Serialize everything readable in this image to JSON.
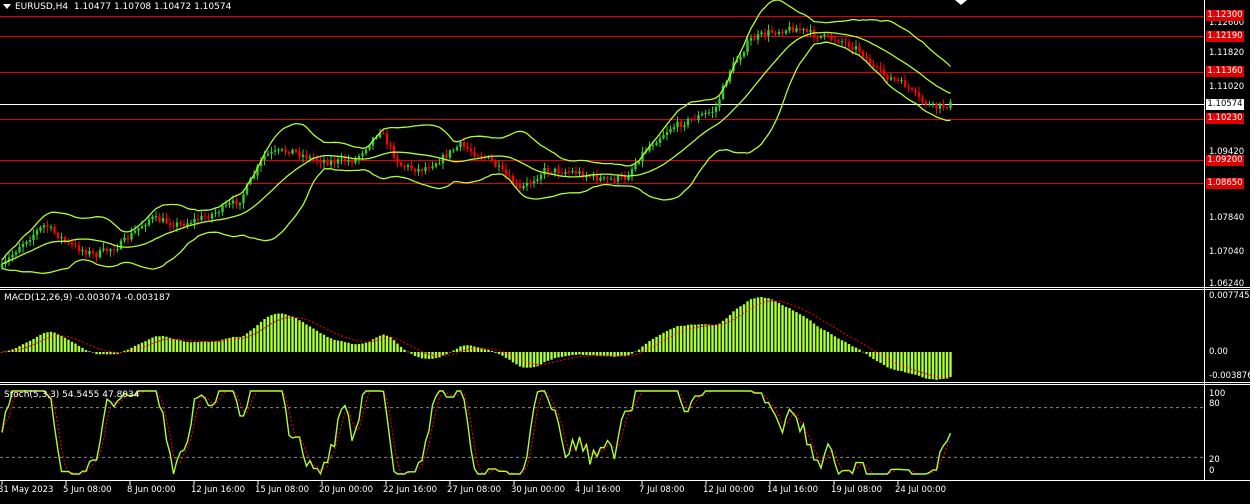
{
  "window": {
    "symbol_label": "EURUSD,H4",
    "ohlc": "1.10477 1.10708 1.10472 1.10574",
    "menu_arrow": "triangle-down"
  },
  "price_axis": {
    "ticks": [
      "1.12600",
      "1.11820",
      "1.11020",
      "1.09420",
      "1.07840",
      "1.07040",
      "1.06240"
    ]
  },
  "price_levels": [
    {
      "label": "1.12300",
      "color": "#e00000"
    },
    {
      "label": "1.12190",
      "color": "#e00000"
    },
    {
      "label": "1.11360",
      "color": "#e00000"
    },
    {
      "label": "1.10574",
      "color": "#ffffff",
      "current": true
    },
    {
      "label": "1.10230",
      "color": "#e00000"
    },
    {
      "label": "1.09200",
      "color": "#e00000"
    },
    {
      "label": "1.08650",
      "color": "#e00000"
    }
  ],
  "macd": {
    "label": "MACD(12,26,9) -0.003074 -0.003187",
    "ticks": [
      "0.007745",
      "0.00",
      "-0.003876"
    ]
  },
  "stoch": {
    "label": "Stoch(5,3,3) 54.5455 47.8034",
    "ticks": [
      "100",
      "80",
      "20",
      "0"
    ]
  },
  "time_axis": {
    "labels": [
      "31 May 2023",
      "5 Jun 08:00",
      "8 Jun 00:00",
      "12 Jun 16:00",
      "15 Jun 08:00",
      "20 Jun 00:00",
      "22 Jun 16:00",
      "27 Jun 08:00",
      "30 Jun 00:00",
      "4 Jul 16:00",
      "7 Jul 08:00",
      "12 Jul 00:00",
      "14 Jul 16:00",
      "19 Jul 08:00",
      "24 Jul 00:00"
    ]
  },
  "colors": {
    "background": "#000000",
    "bull": "#32cd32",
    "bear": "#ff0000",
    "bollinger": "#adff2f",
    "macd_hist": "#adff2f",
    "signal": "#ff0000",
    "level": "#e00000"
  }
}
